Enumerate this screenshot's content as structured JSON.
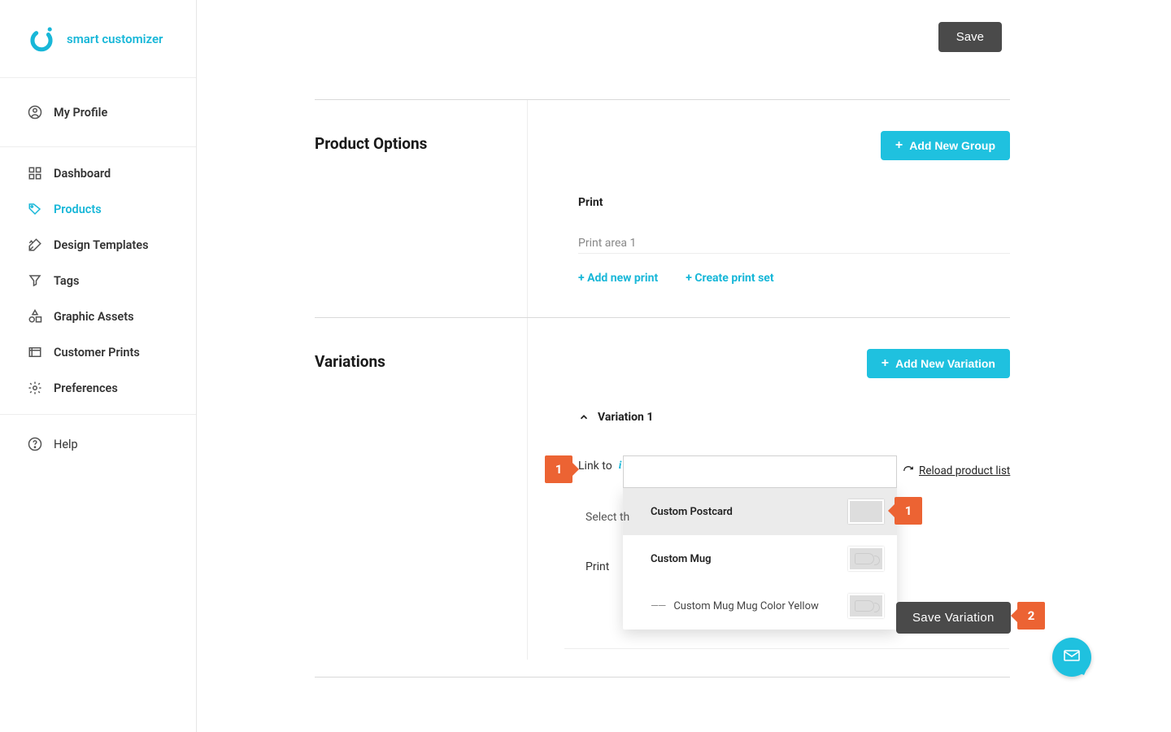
{
  "brand": "smart customizer",
  "sidebar": {
    "profile": "My Profile",
    "items": [
      {
        "label": "Dashboard"
      },
      {
        "label": "Products"
      },
      {
        "label": "Design Templates"
      },
      {
        "label": "Tags"
      },
      {
        "label": "Graphic Assets"
      },
      {
        "label": "Customer Prints"
      },
      {
        "label": "Preferences"
      }
    ],
    "help": "Help"
  },
  "buttons": {
    "save": "Save",
    "addNewGroup": "Add New Group",
    "addNewVariation": "Add New Variation",
    "saveVariation": "Save Variation"
  },
  "productOptions": {
    "title": "Product Options",
    "group": "Print",
    "area": "Print area 1",
    "addNewPrint": "+ Add new print",
    "createPrintSet": "+ Create print set"
  },
  "variations": {
    "title": "Variations",
    "item": "Variation 1",
    "linkTo": "Link to",
    "selectThe": "Select th",
    "printLabel": "Print",
    "reload": "Reload product list",
    "dropdown": [
      {
        "label": "Custom Postcard",
        "highlight": true
      },
      {
        "label": "Custom Mug"
      },
      {
        "label": "Custom Mug Mug Color Yellow",
        "sub": true
      }
    ]
  },
  "callouts": {
    "one": "1",
    "one_b": "1",
    "two": "2"
  }
}
